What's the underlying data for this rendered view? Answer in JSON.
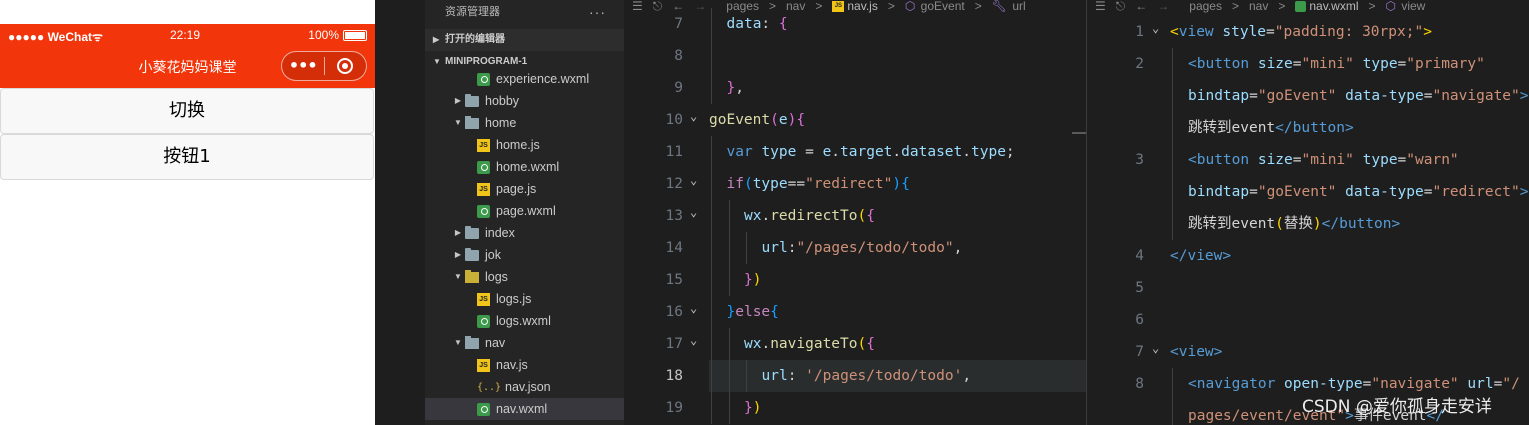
{
  "phone": {
    "carrier": "●●●●● WeChat",
    "wifi": "ᯤ",
    "time": "22:19",
    "battery": "100%",
    "nav_title": "小葵花妈妈课堂",
    "capsule_more": "•••",
    "buttons": [
      "切换",
      "按钮1"
    ],
    "accent_color": "#f2350b"
  },
  "explorer": {
    "header": "资源管理器",
    "more": "···",
    "open_editors": "打开的编辑器",
    "project": "MINIPROGRAM-1",
    "rows": [
      {
        "label": "experience.wxml",
        "icon": "wxml-file-icon",
        "depth": 2,
        "twisty": ""
      },
      {
        "label": "hobby",
        "icon": "folder-icon",
        "depth": 1,
        "twisty": "▶"
      },
      {
        "label": "home",
        "icon": "folder-open-icon",
        "depth": 1,
        "twisty": "▼"
      },
      {
        "label": "home.js",
        "icon": "js-file-icon",
        "depth": 2,
        "twisty": ""
      },
      {
        "label": "home.wxml",
        "icon": "wxml-file-icon",
        "depth": 2,
        "twisty": ""
      },
      {
        "label": "page.js",
        "icon": "js-file-icon",
        "depth": 2,
        "twisty": ""
      },
      {
        "label": "page.wxml",
        "icon": "wxml-file-icon",
        "depth": 2,
        "twisty": ""
      },
      {
        "label": "index",
        "icon": "folder-icon",
        "depth": 1,
        "twisty": "▶"
      },
      {
        "label": "jok",
        "icon": "folder-icon",
        "depth": 1,
        "twisty": "▶"
      },
      {
        "label": "logs",
        "icon": "folder-logs-icon",
        "depth": 1,
        "twisty": "▼"
      },
      {
        "label": "logs.js",
        "icon": "js-file-icon",
        "depth": 2,
        "twisty": ""
      },
      {
        "label": "logs.wxml",
        "icon": "wxml-file-icon",
        "depth": 2,
        "twisty": ""
      },
      {
        "label": "nav",
        "icon": "folder-open-icon",
        "depth": 1,
        "twisty": "▼"
      },
      {
        "label": "nav.js",
        "icon": "js-file-icon",
        "depth": 2,
        "twisty": ""
      },
      {
        "label": "nav.json",
        "icon": "json-file-icon",
        "depth": 2,
        "twisty": ""
      },
      {
        "label": "nav.wxml",
        "icon": "wxml-file-icon",
        "depth": 2,
        "twisty": "",
        "selected": true
      }
    ]
  },
  "editor_js": {
    "breadcrumb": [
      "pages",
      ">",
      "nav",
      ">",
      "nav.js",
      ">",
      "goEvent",
      ">",
      "url"
    ],
    "lines": [
      {
        "n": "7",
        "indent": 1,
        "fold": "",
        "html": "<span class='var'>data</span><span class='punc'>: </span><span class='br2'>{</span>"
      },
      {
        "n": "8",
        "indent": 1,
        "fold": "",
        "html": ""
      },
      {
        "n": "9",
        "indent": 1,
        "fold": "",
        "html": "<span class='br2'>}</span><span class='punc'>,</span>"
      },
      {
        "n": "10",
        "indent": 0,
        "fold": "⌄",
        "html": "<span class='fn'>goEvent</span><span class='br2'>(</span><span class='var'>e</span><span class='br2'>)</span><span class='br2'>{</span>"
      },
      {
        "n": "11",
        "indent": 1,
        "fold": "",
        "html": "<span class='kw'>var</span> <span class='var'>type</span> <span class='punc'>= </span><span class='var'>e</span><span class='punc'>.</span><span class='var'>target</span><span class='punc'>.</span><span class='var'>dataset</span><span class='punc'>.</span><span class='var'>type</span><span class='punc'>;</span>"
      },
      {
        "n": "12",
        "indent": 1,
        "fold": "⌄",
        "html": "<span class='kw2'>if</span><span class='br3'>(</span><span class='var'>type</span><span class='punc'>==</span><span class='str'>\"redirect\"</span><span class='br3'>)</span><span class='br3'>{</span>"
      },
      {
        "n": "13",
        "indent": 2,
        "fold": "⌄",
        "html": "<span class='var'>wx</span><span class='punc'>.</span><span class='fn'>redirectTo</span><span class='br1'>(</span><span class='br2'>{</span>"
      },
      {
        "n": "14",
        "indent": 3,
        "fold": "",
        "html": "<span class='var'>url</span><span class='punc'>:</span><span class='str'>\"/pages/todo/todo\"</span><span class='punc'>,</span>"
      },
      {
        "n": "15",
        "indent": 2,
        "fold": "",
        "html": "<span class='br2'>}</span><span class='br1'>)</span>"
      },
      {
        "n": "16",
        "indent": 1,
        "fold": "⌄",
        "html": "<span class='br3'>}</span><span class='kw2'>else</span><span class='br3'>{</span>"
      },
      {
        "n": "17",
        "indent": 2,
        "fold": "⌄",
        "html": "<span class='var'>wx</span><span class='punc'>.</span><span class='fn'>navigateTo</span><span class='br1'>(</span><span class='br2'>{</span>"
      },
      {
        "n": "18",
        "indent": 3,
        "fold": "",
        "current": true,
        "html": "<span class='var'>url</span><span class='punc'>: </span><span class='str'>'/pages/todo/todo'</span><span class='punc'>,</span>"
      },
      {
        "n": "19",
        "indent": 2,
        "fold": "",
        "html": "<span class='br2'>}</span><span class='br1'>)</span>"
      }
    ]
  },
  "editor_wxml": {
    "breadcrumb": [
      "pages",
      ">",
      "nav",
      ">",
      "nav.wxml",
      ">",
      "view"
    ],
    "lines": [
      {
        "n": "1",
        "indent": 0,
        "fold": "⌄",
        "html": "<span class='br1'>&lt;</span><span class='tag'>view</span> <span class='attr'>style</span><span class='punc'>=</span><span class='str'>\"padding: 30rpx;\"</span><span class='br1'>&gt;</span>"
      },
      {
        "n": "2",
        "indent": 1,
        "fold": "",
        "html": "<span class='tag'>&lt;button</span> <span class='attr'>size</span><span class='punc'>=</span><span class='str'>\"mini\"</span> <span class='attr'>type</span><span class='punc'>=</span><span class='str'>\"primary\"</span>"
      },
      {
        "n": "",
        "indent": 1,
        "fold": "",
        "html": "<span class='attr'>bindtap</span><span class='punc'>=</span><span class='str'>\"goEvent\"</span> <span class='attr'>data-type</span><span class='punc'>=</span><span class='str'>\"navigate\"</span><span class='tag'>&gt;</span>"
      },
      {
        "n": "",
        "indent": 1,
        "fold": "",
        "html": "<span class='punc'>跳转到event</span><span class='tag'>&lt;/button&gt;</span>"
      },
      {
        "n": "3",
        "indent": 1,
        "fold": "",
        "html": "<span class='tag'>&lt;button</span> <span class='attr'>size</span><span class='punc'>=</span><span class='str'>\"mini\"</span> <span class='attr'>type</span><span class='punc'>=</span><span class='str'>\"warn\"</span>"
      },
      {
        "n": "",
        "indent": 1,
        "fold": "",
        "html": "<span class='attr'>bindtap</span><span class='punc'>=</span><span class='str'>\"goEvent\"</span> <span class='attr'>data-type</span><span class='punc'>=</span><span class='str'>\"redirect\"</span><span class='tag'>&gt;</span>"
      },
      {
        "n": "",
        "indent": 1,
        "fold": "",
        "html": "<span class='punc'>跳转到event</span><span class='br1'>(</span><span class='punc'>替换</span><span class='br1'>)</span><span class='tag'>&lt;/button&gt;</span>"
      },
      {
        "n": "4",
        "indent": 0,
        "fold": "",
        "html": "<span class='tag'>&lt;/view&gt;</span>"
      },
      {
        "n": "5",
        "indent": 0,
        "fold": "",
        "html": ""
      },
      {
        "n": "6",
        "indent": 0,
        "fold": "",
        "html": ""
      },
      {
        "n": "7",
        "indent": 0,
        "fold": "⌄",
        "html": "<span class='tag'>&lt;view&gt;</span>"
      },
      {
        "n": "8",
        "indent": 1,
        "fold": "",
        "html": "<span class='tag'>&lt;navigator</span> <span class='attr'>open-type</span><span class='punc'>=</span><span class='str'>\"navigate\"</span> <span class='attr'>url</span><span class='punc'>=</span><span class='str'>\"/</span>"
      },
      {
        "n": "",
        "indent": 1,
        "fold": "",
        "html": "<span class='str'>pages/event/event\"</span><span class='tag'>&gt;</span><span class='punc'>事件event</span><span class='tag'>&lt;/</span>"
      }
    ]
  },
  "watermark": "CSDN @爱你孤身走安详"
}
